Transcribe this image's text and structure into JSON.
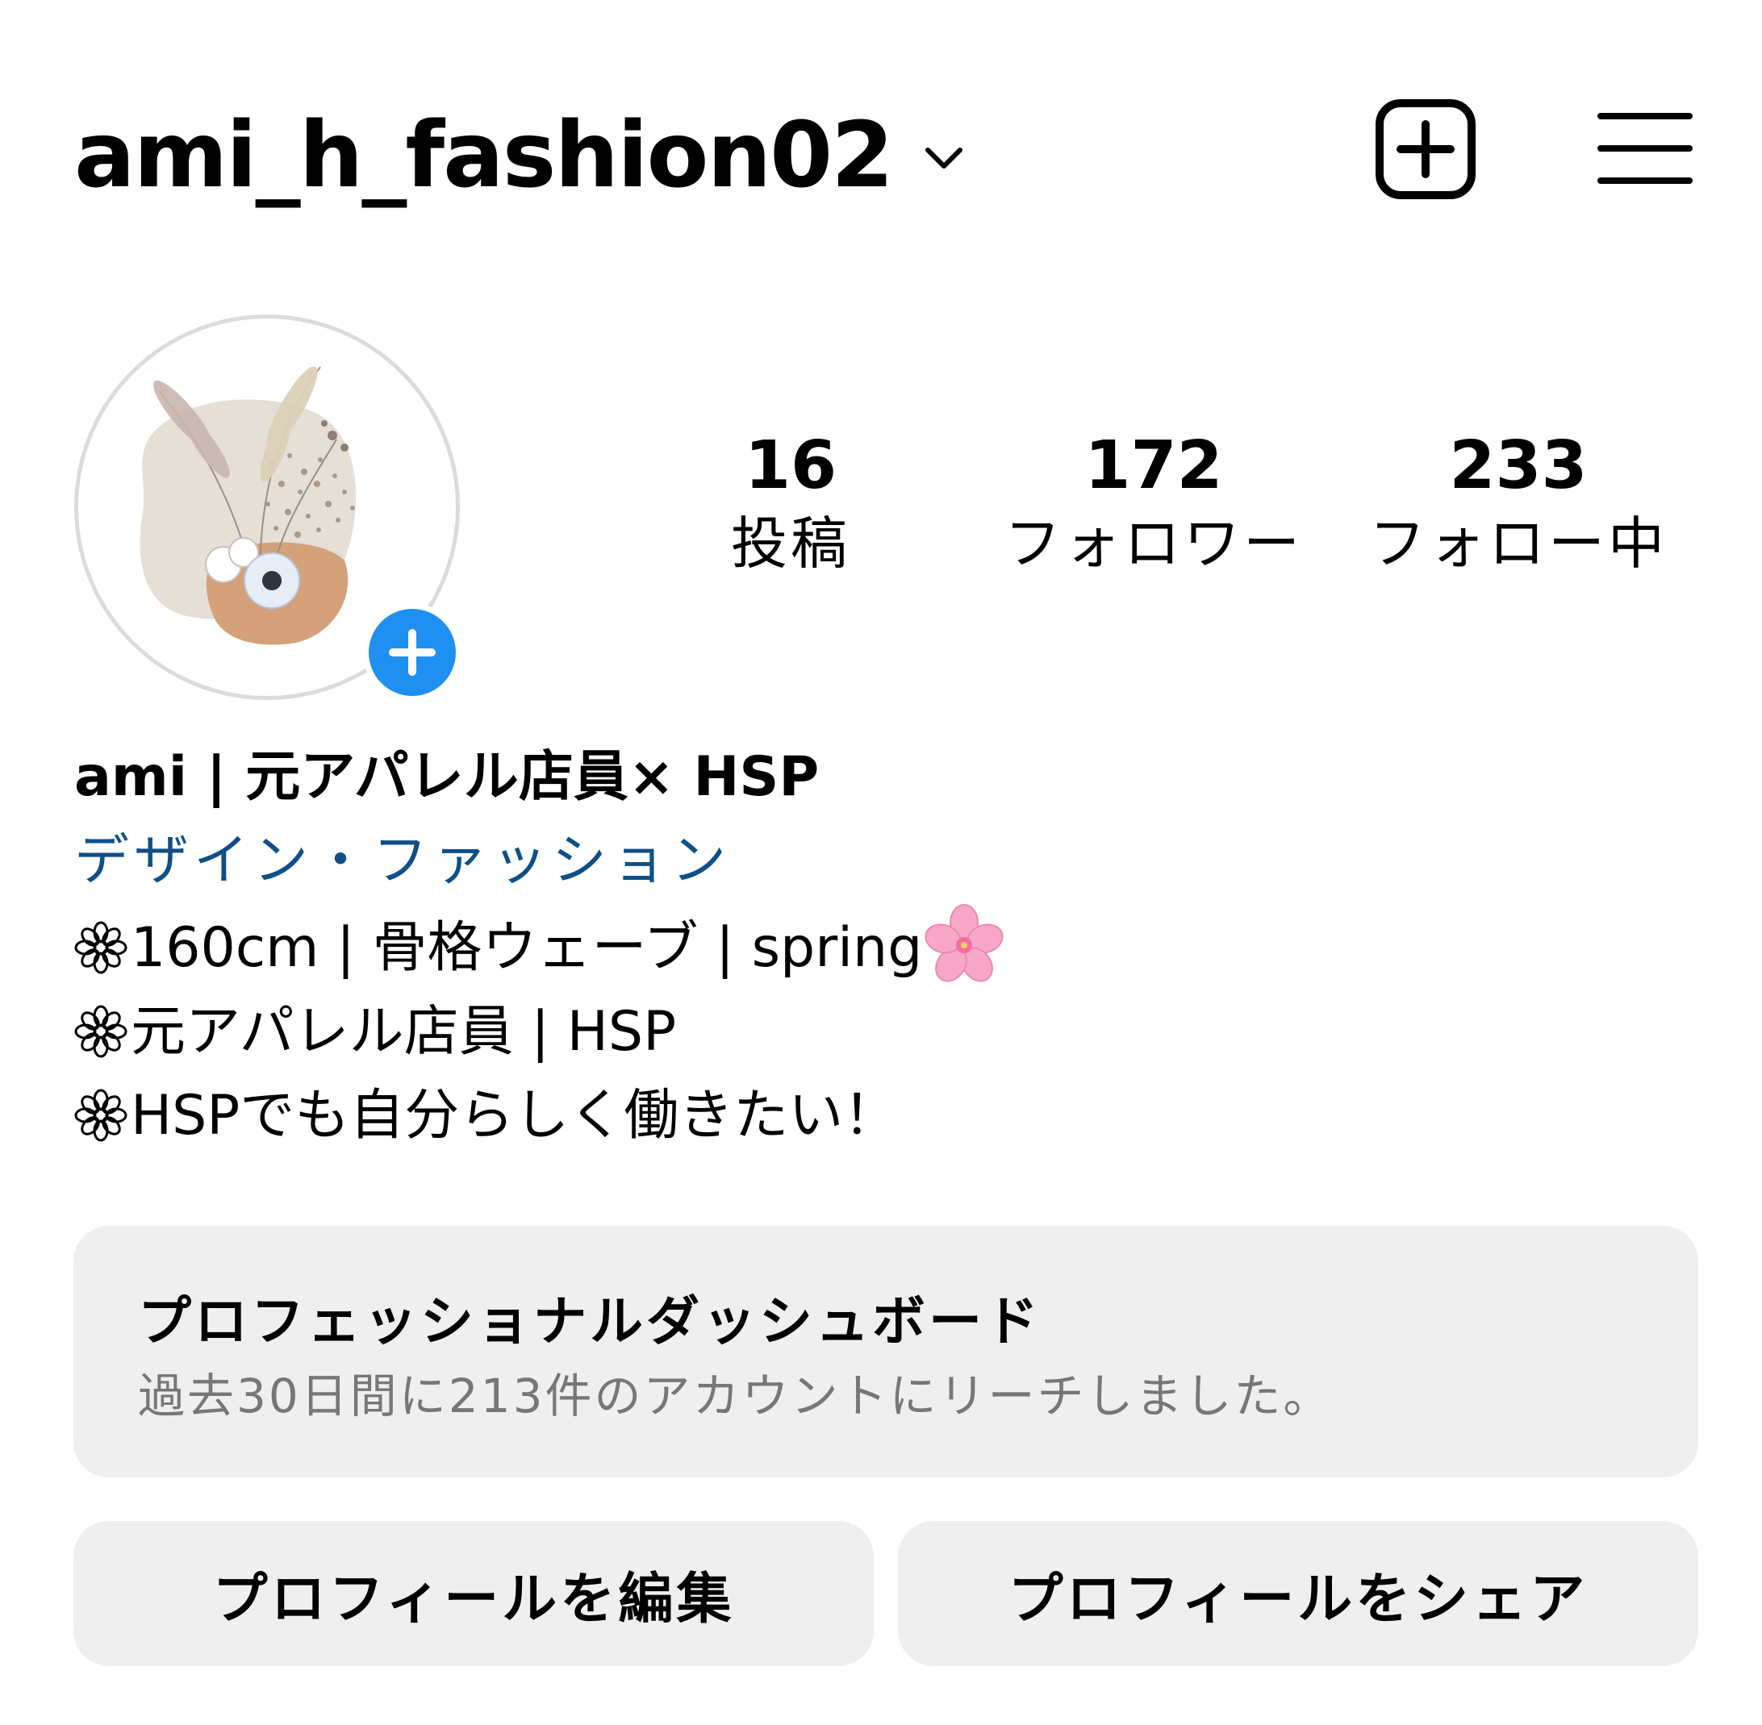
{
  "header": {
    "username": "ami_h_fashion02",
    "dropdown_icon": "chevron-down-icon",
    "new_post_icon": "plus-square-icon",
    "menu_icon": "hamburger-menu-icon"
  },
  "profile": {
    "avatar_icon": "dried-flower-illustration",
    "add_story_icon": "plus-circle-icon",
    "add_story_color": "#1f8ff2"
  },
  "stats": {
    "posts": {
      "count": "16",
      "label": "投稿"
    },
    "followers": {
      "count": "172",
      "label": "フォロワー"
    },
    "following": {
      "count": "233",
      "label": "フォロー中"
    }
  },
  "bio": {
    "name": "ami | 元アパレル店員× HSP",
    "category": "デザイン・ファッション",
    "category_color": "#0f4f87",
    "lines": [
      {
        "icon": "flower-outline-icon",
        "text": "160cm | 骨格ウェーブ | spring",
        "trailing_icon": "cherry-blossom-icon"
      },
      {
        "icon": "flower-outline-icon",
        "text": "元アパレル店員 | HSP"
      },
      {
        "icon": "flower-outline-icon",
        "text": "HSPでも自分らしく働きたい！"
      }
    ]
  },
  "dashboard": {
    "title": "プロフェッショナルダッシュボード",
    "subtitle": "過去30日間に213件のアカウントにリーチしました。"
  },
  "actions": {
    "edit_profile": "プロフィールを編集",
    "share_profile": "プロフィールをシェア"
  }
}
